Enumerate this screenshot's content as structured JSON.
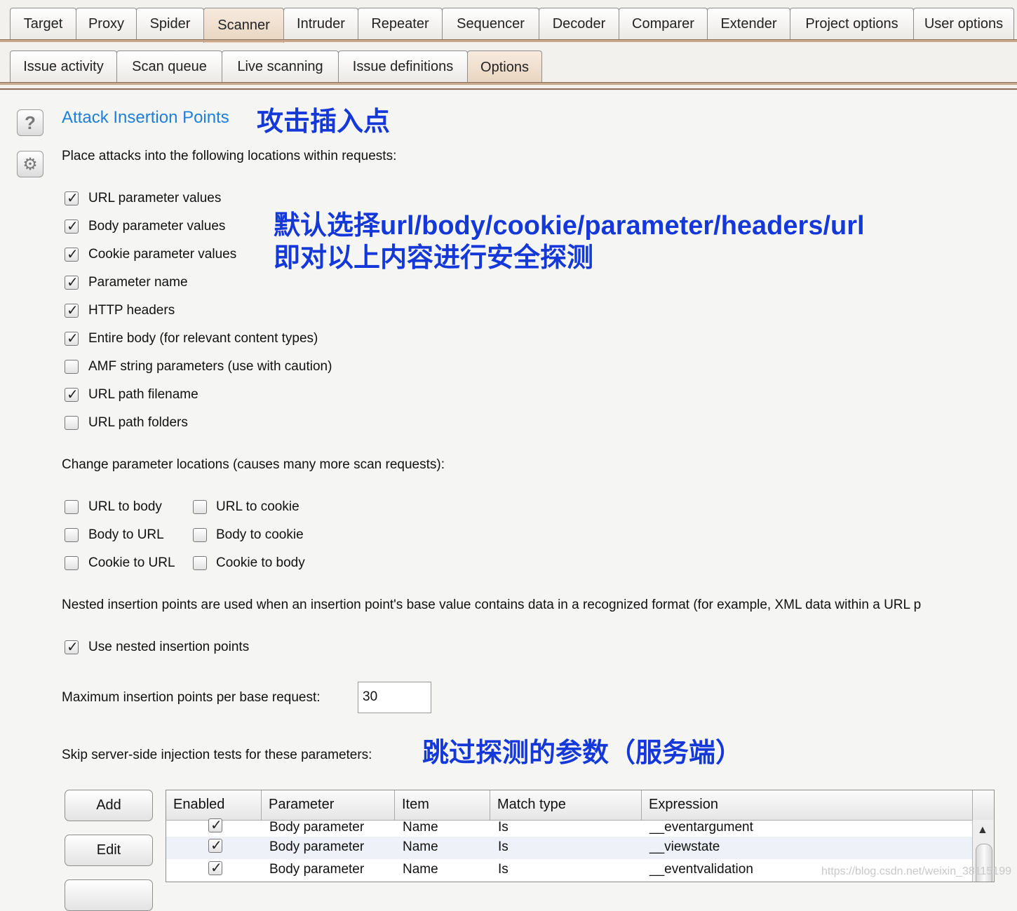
{
  "top_tabs": [
    {
      "label": "Target",
      "selected": false
    },
    {
      "label": "Proxy",
      "selected": false
    },
    {
      "label": "Spider",
      "selected": false
    },
    {
      "label": "Scanner",
      "selected": true
    },
    {
      "label": "Intruder",
      "selected": false
    },
    {
      "label": "Repeater",
      "selected": false
    },
    {
      "label": "Sequencer",
      "selected": false
    },
    {
      "label": "Decoder",
      "selected": false
    },
    {
      "label": "Comparer",
      "selected": false
    },
    {
      "label": "Extender",
      "selected": false
    },
    {
      "label": "Project options",
      "selected": false
    },
    {
      "label": "User options",
      "selected": false
    }
  ],
  "sub_tabs": [
    {
      "label": "Issue activity",
      "selected": false
    },
    {
      "label": "Scan queue",
      "selected": false
    },
    {
      "label": "Live scanning",
      "selected": false
    },
    {
      "label": "Issue definitions",
      "selected": false
    },
    {
      "label": "Options",
      "selected": true
    }
  ],
  "side_icons": {
    "help": "?",
    "settings": "⚙"
  },
  "section": {
    "title": "Attack Insertion Points",
    "intro": "Place attacks into the following locations within requests:"
  },
  "annotations": {
    "title_cn": "攻击插入点",
    "default_line1": "默认选择url/body/cookie/parameter/headers/url",
    "default_line2": "即对以上内容进行安全探测",
    "skip_cn": "跳过探测的参数（服务端）"
  },
  "locations": [
    {
      "label": "URL parameter values",
      "checked": true
    },
    {
      "label": "Body parameter values",
      "checked": true
    },
    {
      "label": "Cookie parameter values",
      "checked": true
    },
    {
      "label": "Parameter name",
      "checked": true
    },
    {
      "label": "HTTP headers",
      "checked": true
    },
    {
      "label": "Entire body (for relevant content types)",
      "checked": true
    },
    {
      "label": "AMF string parameters (use with caution)",
      "checked": false
    },
    {
      "label": "URL path filename",
      "checked": true
    },
    {
      "label": "URL path folders",
      "checked": false
    }
  ],
  "change_locations": {
    "heading": "Change parameter locations (causes many more scan requests):",
    "left": [
      {
        "label": "URL to body",
        "checked": false
      },
      {
        "label": "Body to URL",
        "checked": false
      },
      {
        "label": "Cookie to URL",
        "checked": false
      }
    ],
    "right": [
      {
        "label": "URL to cookie",
        "checked": false
      },
      {
        "label": "Body to cookie",
        "checked": false
      },
      {
        "label": "Cookie to body",
        "checked": false
      }
    ]
  },
  "nested": {
    "description": "Nested insertion points are used when an insertion point's base value contains data in a recognized format (for example, XML data within a URL p",
    "use_label": "Use nested insertion points",
    "use_checked": true
  },
  "max_points": {
    "label": "Maximum insertion points per base request:",
    "value": "30"
  },
  "skip": {
    "label": "Skip server-side injection tests for these parameters:"
  },
  "buttons": {
    "add": "Add",
    "edit": "Edit"
  },
  "table": {
    "columns": [
      "Enabled",
      "Parameter",
      "Item",
      "Match type",
      "Expression"
    ],
    "rows": [
      {
        "enabled": true,
        "parameter": "Body parameter",
        "item": "Name",
        "match": "Is",
        "expression": "__eventargument"
      },
      {
        "enabled": true,
        "parameter": "Body parameter",
        "item": "Name",
        "match": "Is",
        "expression": "__viewstate"
      },
      {
        "enabled": true,
        "parameter": "Body parameter",
        "item": "Name",
        "match": "Is",
        "expression": "__eventvalidation"
      }
    ]
  },
  "watermark": "https://blog.csdn.net/weixin_38115199"
}
